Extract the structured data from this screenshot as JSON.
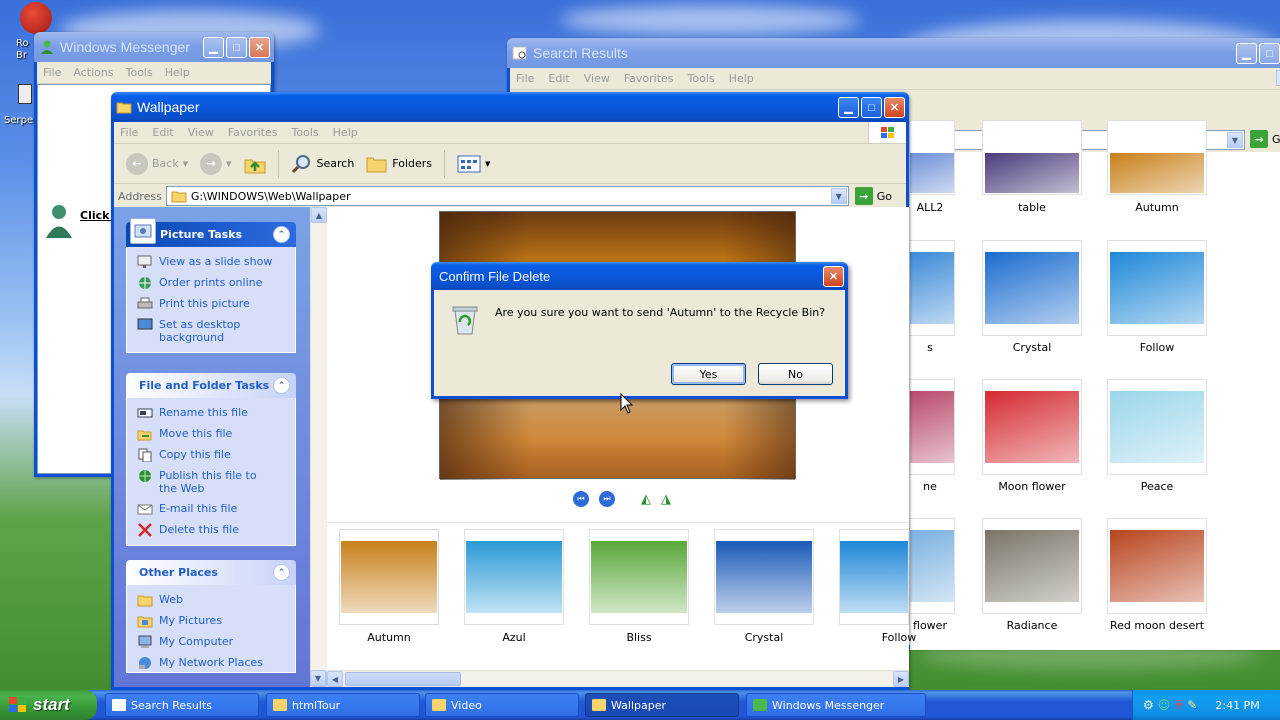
{
  "desktop": {
    "icon_labels": [
      "Ro Br",
      "Serpe"
    ]
  },
  "messenger": {
    "title": "Windows Messenger",
    "menu": [
      "File",
      "Actions",
      "Tools",
      "Help"
    ],
    "click_text": "Click h"
  },
  "search_results": {
    "title": "Search Results",
    "menu": [
      "File",
      "Edit",
      "View",
      "Favorites",
      "Tools",
      "Help"
    ],
    "go_label": "Go",
    "files": [
      {
        "name": "ALL2",
        "color": "#6d8fd8"
      },
      {
        "name": "table",
        "color": "#4a3a7a"
      },
      {
        "name": "Autumn",
        "color": "#c8801a"
      },
      {
        "name": "s",
        "color": "#3b8ad8"
      },
      {
        "name": "Crystal",
        "color": "#1a6ccf"
      },
      {
        "name": "Follow",
        "color": "#1e88d8"
      },
      {
        "name": "ne",
        "color": "#b84a6a"
      },
      {
        "name": "Moon flower",
        "color": "#d42a30"
      },
      {
        "name": "Peace",
        "color": "#9bd6ea"
      },
      {
        "name": "flower",
        "color": "#7ab0e0"
      },
      {
        "name": "Radiance",
        "color": "#7a7466"
      },
      {
        "name": "Red moon desert",
        "color": "#b8441e"
      }
    ]
  },
  "wallpaper": {
    "title": "Wallpaper",
    "menu": [
      "File",
      "Edit",
      "View",
      "Favorites",
      "Tools",
      "Help"
    ],
    "toolbar": {
      "back": "Back",
      "search": "Search",
      "folders": "Folders"
    },
    "address_label": "Address",
    "address": "G:\\WINDOWS\\Web\\Wallpaper",
    "go_label": "Go",
    "picture_tasks": {
      "title": "Picture Tasks",
      "items": [
        "View as a slide show",
        "Order prints online",
        "Print this picture",
        "Set as desktop background"
      ]
    },
    "file_tasks": {
      "title": "File and Folder Tasks",
      "items": [
        "Rename this file",
        "Move this file",
        "Copy this file",
        "Publish this file to the Web",
        "E-mail this file",
        "Delete this file"
      ]
    },
    "other_places": {
      "title": "Other Places",
      "items": [
        "Web",
        "My Pictures",
        "My Computer",
        "My Network Places"
      ]
    },
    "filmstrip": [
      "Autumn",
      "Azul",
      "Bliss",
      "Crystal",
      "Follow"
    ]
  },
  "dialog": {
    "title": "Confirm File Delete",
    "message": "Are you sure you want to send 'Autumn' to the Recycle Bin?",
    "yes": "Yes",
    "no": "No"
  },
  "taskbar": {
    "start": "start",
    "tasks": [
      "Search Results",
      "htmlTour",
      "Video",
      "Wallpaper",
      "Windows Messenger"
    ],
    "active_task": "Wallpaper",
    "clock": "2:41 PM"
  }
}
